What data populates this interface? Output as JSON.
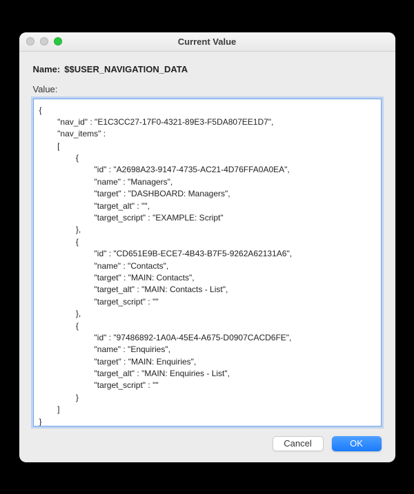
{
  "window": {
    "title": "Current Value"
  },
  "labels": {
    "name_label": "Name:",
    "value_label": "Value:"
  },
  "fields": {
    "name_value": "$$USER_NAVIGATION_DATA",
    "value_text": "{\n\t\"nav_id\" : \"E1C3CC27-17F0-4321-89E3-F5DA807EE1D7\",\n\t\"nav_items\" : \n\t[\n\t\t{\n\t\t\t\"id\" : \"A2698A23-9147-4735-AC21-4D76FFA0A0EA\",\n\t\t\t\"name\" : \"Managers\",\n\t\t\t\"target\" : \"DASHBOARD: Managers\",\n\t\t\t\"target_alt\" : \"\",\n\t\t\t\"target_script\" : \"EXAMPLE: Script\"\n\t\t},\n\t\t{\n\t\t\t\"id\" : \"CD651E9B-ECE7-4B43-B7F5-9262A62131A6\",\n\t\t\t\"name\" : \"Contacts\",\n\t\t\t\"target\" : \"MAIN: Contacts\",\n\t\t\t\"target_alt\" : \"MAIN: Contacts - List\",\n\t\t\t\"target_script\" : \"\"\n\t\t},\n\t\t{\n\t\t\t\"id\" : \"97486892-1A0A-45E4-A675-D0907CACD6FE\",\n\t\t\t\"name\" : \"Enquiries\",\n\t\t\t\"target\" : \"MAIN: Enquiries\",\n\t\t\t\"target_alt\" : \"MAIN: Enquiries - List\",\n\t\t\t\"target_script\" : \"\"\n\t\t}\n\t]\n}"
  },
  "buttons": {
    "cancel": "Cancel",
    "ok": "OK"
  }
}
